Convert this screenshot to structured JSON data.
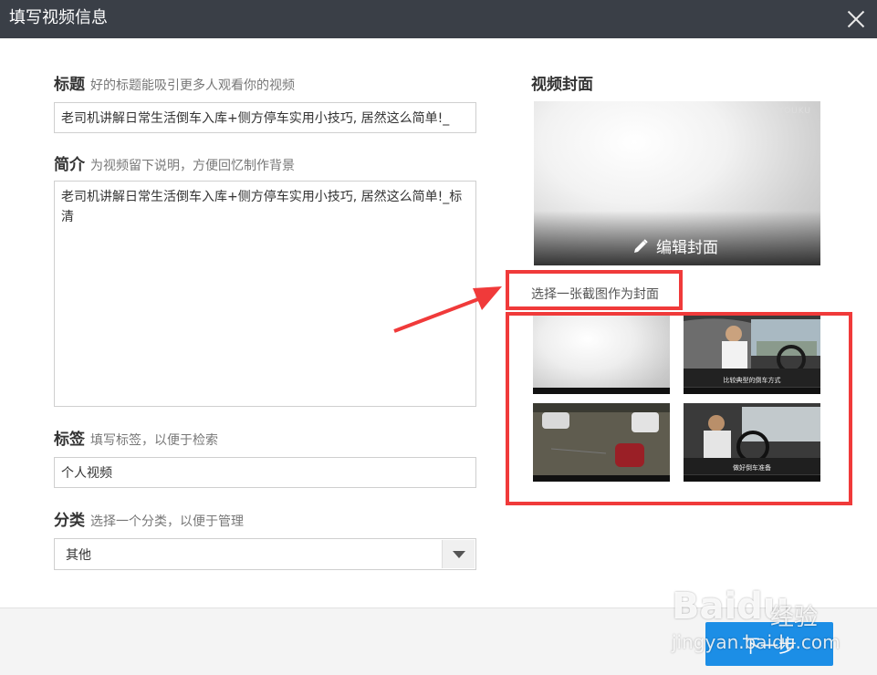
{
  "dialog": {
    "title": "填写视频信息"
  },
  "form": {
    "title_field": {
      "label": "标题",
      "hint": "好的标题能吸引更多人观看你的视频",
      "value": "老司机讲解日常生活倒车入库+侧方停车实用小技巧, 居然这么简单!_"
    },
    "intro_field": {
      "label": "简介",
      "hint": "为视频留下说明，方便回忆制作背景",
      "value": "老司机讲解日常生活倒车入库+侧方停车实用小技巧, 居然这么简单!_标清"
    },
    "tags_field": {
      "label": "标签",
      "hint": "填写标签，以便于检索",
      "value": "个人视频"
    },
    "category_field": {
      "label": "分类",
      "hint": "选择一个分类，以便于管理",
      "selected": "其他"
    }
  },
  "cover": {
    "title": "视频封面",
    "watermark": "YOUKU",
    "edit_label": "编辑封面",
    "pick_label": "选择一张截图作为封面",
    "thumbnails": [
      {
        "subtitle": ""
      },
      {
        "subtitle": "比较典型的倒车方式"
      },
      {
        "subtitle": ""
      },
      {
        "subtitle": "做好倒车准备"
      }
    ]
  },
  "footer": {
    "next_label": "下一步"
  },
  "watermark": {
    "brand": "Baidu",
    "suffix": "经验",
    "url": "jingyan.baidu.com"
  },
  "colors": {
    "titlebar": "#3a3f47",
    "primary": "#1c8ee6",
    "highlight": "#f03a3a"
  }
}
